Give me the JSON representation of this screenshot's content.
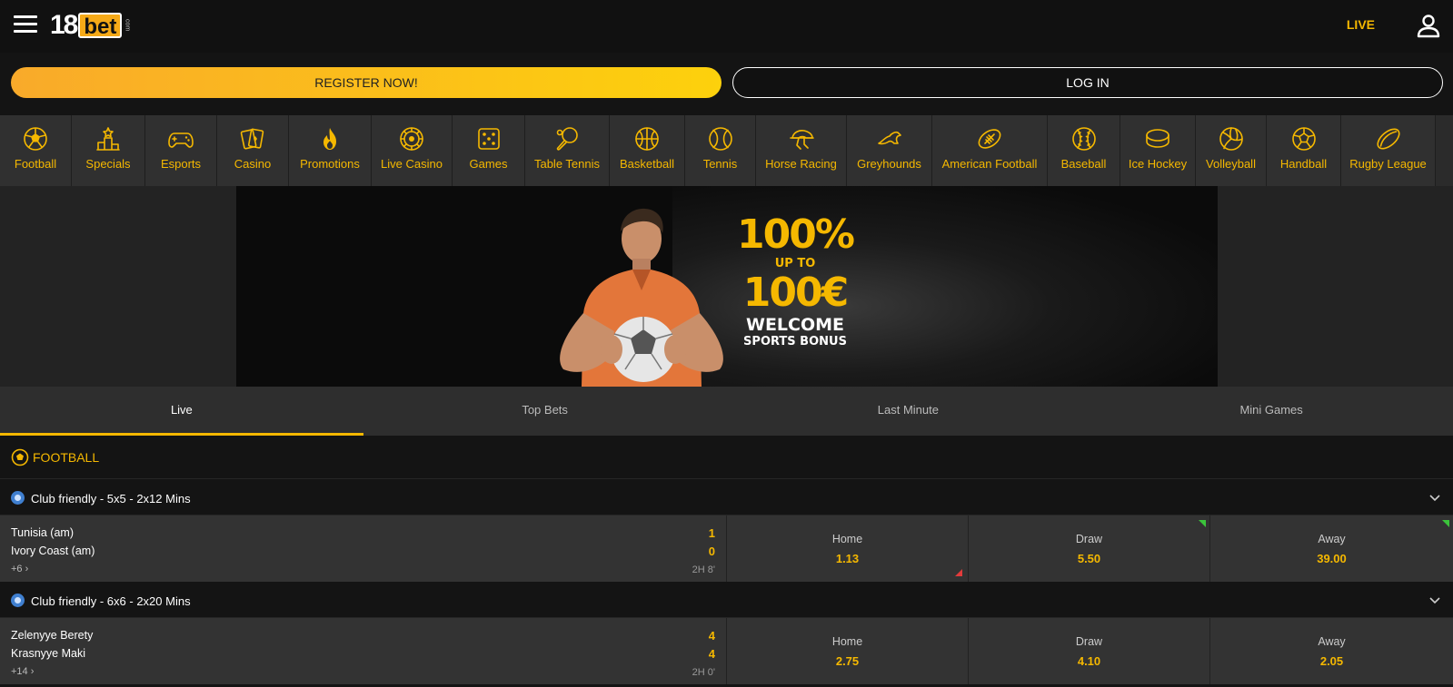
{
  "header": {
    "live_label": "LIVE",
    "logo_number": "18",
    "logo_word": "bet",
    "logo_suffix": "com"
  },
  "auth": {
    "register_label": "REGISTER NOW!",
    "login_label": "LOG IN"
  },
  "sports_nav": [
    {
      "label": "Football",
      "icon": "football-icon"
    },
    {
      "label": "Specials",
      "icon": "podium-icon"
    },
    {
      "label": "Esports",
      "icon": "gamepad-icon"
    },
    {
      "label": "Casino",
      "icon": "cards-icon"
    },
    {
      "label": "Promotions",
      "icon": "flame-icon"
    },
    {
      "label": "Live Casino",
      "icon": "roulette-icon"
    },
    {
      "label": "Games",
      "icon": "dice-icon"
    },
    {
      "label": "Table Tennis",
      "icon": "table-tennis-icon"
    },
    {
      "label": "Basketball",
      "icon": "basketball-icon"
    },
    {
      "label": "Tennis",
      "icon": "tennis-ball-icon"
    },
    {
      "label": "Horse Racing",
      "icon": "horse-racing-icon"
    },
    {
      "label": "Greyhounds",
      "icon": "greyhound-icon"
    },
    {
      "label": "American Football",
      "icon": "american-football-icon"
    },
    {
      "label": "Baseball",
      "icon": "baseball-icon"
    },
    {
      "label": "Ice Hockey",
      "icon": "puck-icon"
    },
    {
      "label": "Volleyball",
      "icon": "volleyball-icon"
    },
    {
      "label": "Handball",
      "icon": "handball-icon"
    },
    {
      "label": "Rugby League",
      "icon": "rugby-ball-icon"
    }
  ],
  "banner": {
    "percent": "100%",
    "up_to": "UP TO",
    "amount": "100€",
    "welcome": "WELCOME",
    "sports_bonus": "SPORTS BONUS"
  },
  "tabs": [
    {
      "label": "Live",
      "active": true
    },
    {
      "label": "Top Bets",
      "active": false
    },
    {
      "label": "Last Minute",
      "active": false
    },
    {
      "label": "Mini Games",
      "active": false
    }
  ],
  "section": {
    "title": "FOOTBALL"
  },
  "leagues": [
    {
      "name": "Club friendly - 5x5 - 2x12 Mins",
      "match": {
        "home_team": "Tunisia (am)",
        "away_team": "Ivory Coast (am)",
        "home_score": "1",
        "away_score": "0",
        "more_markets": "+6",
        "time": "2H 8'",
        "odds": [
          {
            "label": "Home",
            "value": "1.13",
            "trend": "down"
          },
          {
            "label": "Draw",
            "value": "5.50",
            "trend": "up"
          },
          {
            "label": "Away",
            "value": "39.00",
            "trend": "up"
          }
        ]
      }
    },
    {
      "name": "Club friendly - 6x6 - 2x20 Mins",
      "match": {
        "home_team": "Zelenyye Berety",
        "away_team": "Krasnyye Maki",
        "home_score": "4",
        "away_score": "4",
        "more_markets": "+14",
        "time": "2H 0'",
        "odds": [
          {
            "label": "Home",
            "value": "2.75",
            "trend": "none"
          },
          {
            "label": "Draw",
            "value": "4.10",
            "trend": "none"
          },
          {
            "label": "Away",
            "value": "2.05",
            "trend": "none"
          }
        ]
      }
    }
  ],
  "colors": {
    "accent": "#f5b800",
    "background": "#141414",
    "panel": "#333333",
    "odds_up": "#3bc43b",
    "odds_down": "#e23b3b"
  }
}
